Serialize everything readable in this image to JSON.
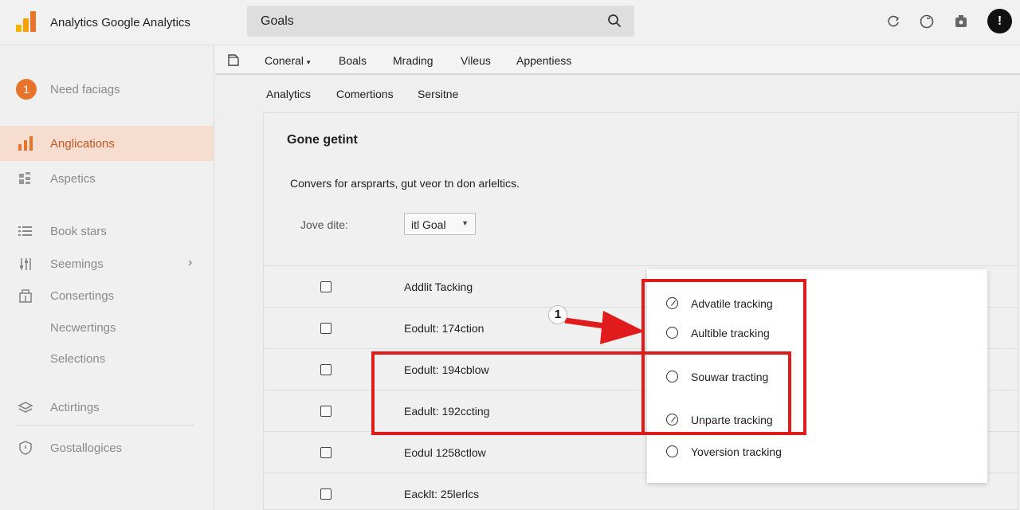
{
  "header": {
    "app_title": "Analytics Google Analytics",
    "search_value": "Goals",
    "avatar_label": "!"
  },
  "sidebar": {
    "items": [
      {
        "label": "Need faciags",
        "badge": "1"
      },
      {
        "label": "Anglications",
        "active": true
      },
      {
        "label": "Aspetics"
      },
      {
        "label": "Book stars"
      },
      {
        "label": "Seemings"
      },
      {
        "label": "Consertings"
      },
      {
        "label": "Necwertings"
      },
      {
        "label": "Selections"
      },
      {
        "label": "Actirtings"
      },
      {
        "label": "Gostallogices"
      }
    ]
  },
  "tabs": [
    "Coneral",
    "Boals",
    "Mrading",
    "Vileus",
    "Appentiess"
  ],
  "subtabs": [
    "Analytics",
    "Comertions",
    "Sersitne"
  ],
  "card": {
    "title": "Gone getint",
    "description": "Convers for arsprarts, gut veor tn don arleltics.",
    "goal_label": "Jove dite:",
    "goal_select_value": "itl Goal",
    "rows": [
      "Addlit Tacking",
      "Eodult: 174ction",
      "Eodult: 194cblow",
      "Eadult: 192ccting",
      "Eodul 1258ctlow",
      "Eacklt: 25lerlcs"
    ]
  },
  "panel": {
    "options": [
      {
        "label": "Advatile tracking",
        "checked": true
      },
      {
        "label": "Aultible tracking",
        "checked": false
      },
      {
        "label": "Souwar tracting",
        "checked": false
      },
      {
        "label": "Unparte tracking",
        "checked": true
      },
      {
        "label": "Yoversion tracking",
        "checked": false
      }
    ]
  },
  "annotation": {
    "callout_number": "1"
  },
  "colors": {
    "accent": "#e8742c",
    "highlight": "#e01b1b",
    "active_bg": "#f7ddcf"
  }
}
